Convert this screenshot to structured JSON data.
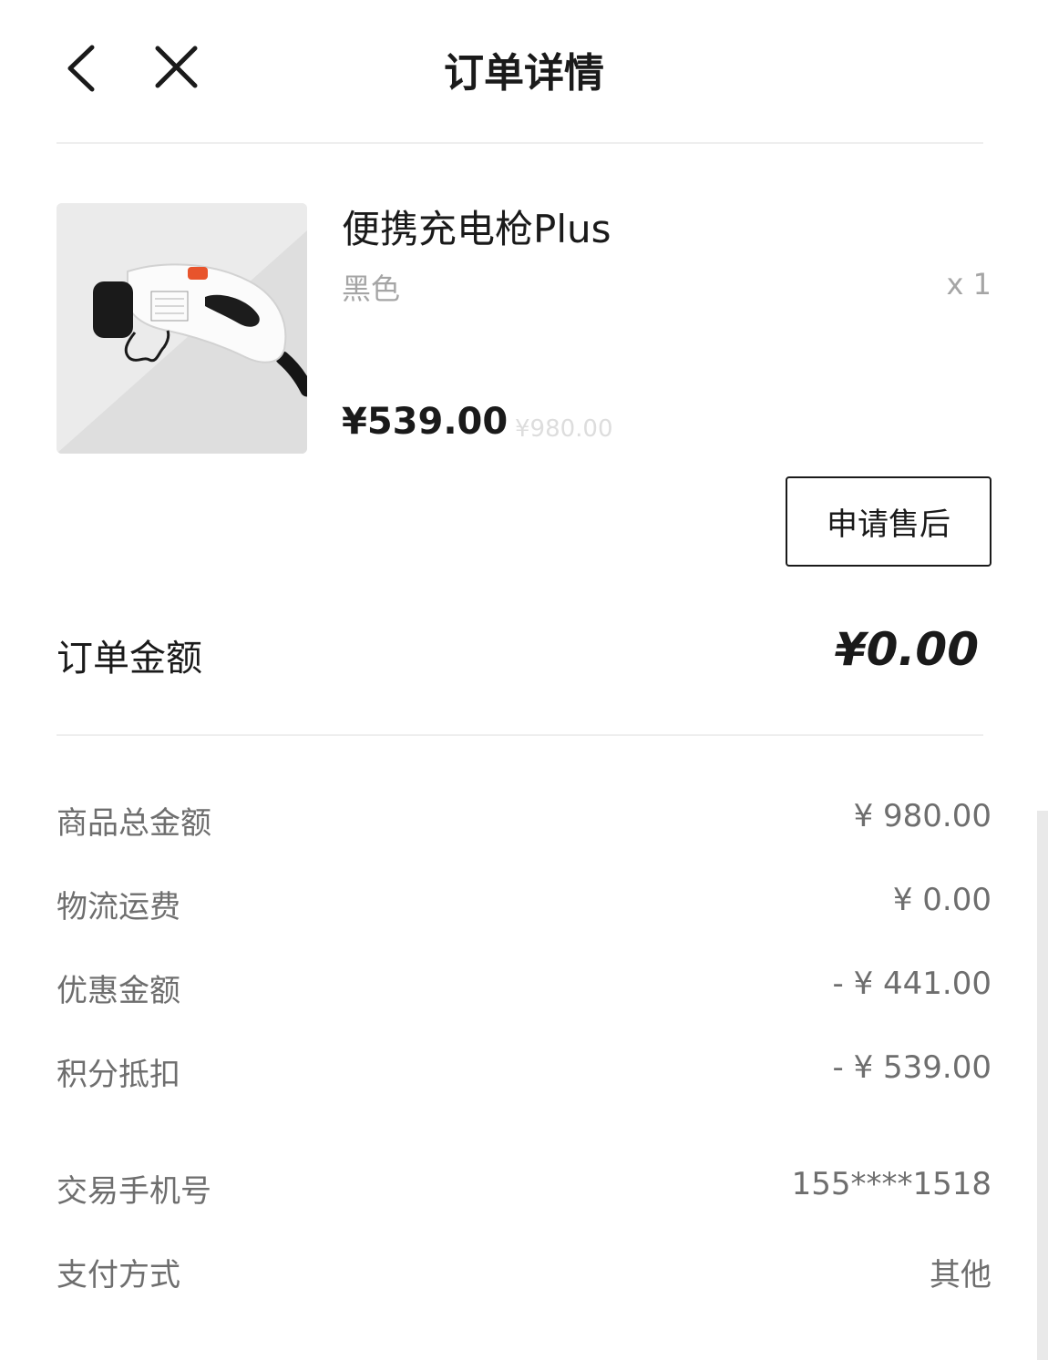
{
  "header": {
    "title": "订单详情",
    "back_icon": "chevron-left-icon",
    "close_icon": "close-icon"
  },
  "product": {
    "name": "便携充电枪Plus",
    "variant": "黑色",
    "quantity": "x 1",
    "price": "¥539.00",
    "original_price": "¥980.00",
    "image_icon": "charging-gun-image",
    "accent_color": "#e8542c"
  },
  "actions": {
    "after_sale_label": "申请售后"
  },
  "order_amount": {
    "label": "订单金额",
    "value": "¥0.00"
  },
  "details": {
    "total_goods": {
      "label": "商品总金额",
      "value": "¥ 980.00"
    },
    "shipping": {
      "label": "物流运费",
      "value": "¥ 0.00"
    },
    "discount": {
      "label": "优惠金额",
      "value": "- ¥ 441.00"
    },
    "points": {
      "label": "积分抵扣",
      "value": "- ¥ 539.00"
    },
    "phone": {
      "label": "交易手机号",
      "value": "155****1518"
    },
    "payment": {
      "label": "支付方式",
      "value": "其他"
    }
  }
}
